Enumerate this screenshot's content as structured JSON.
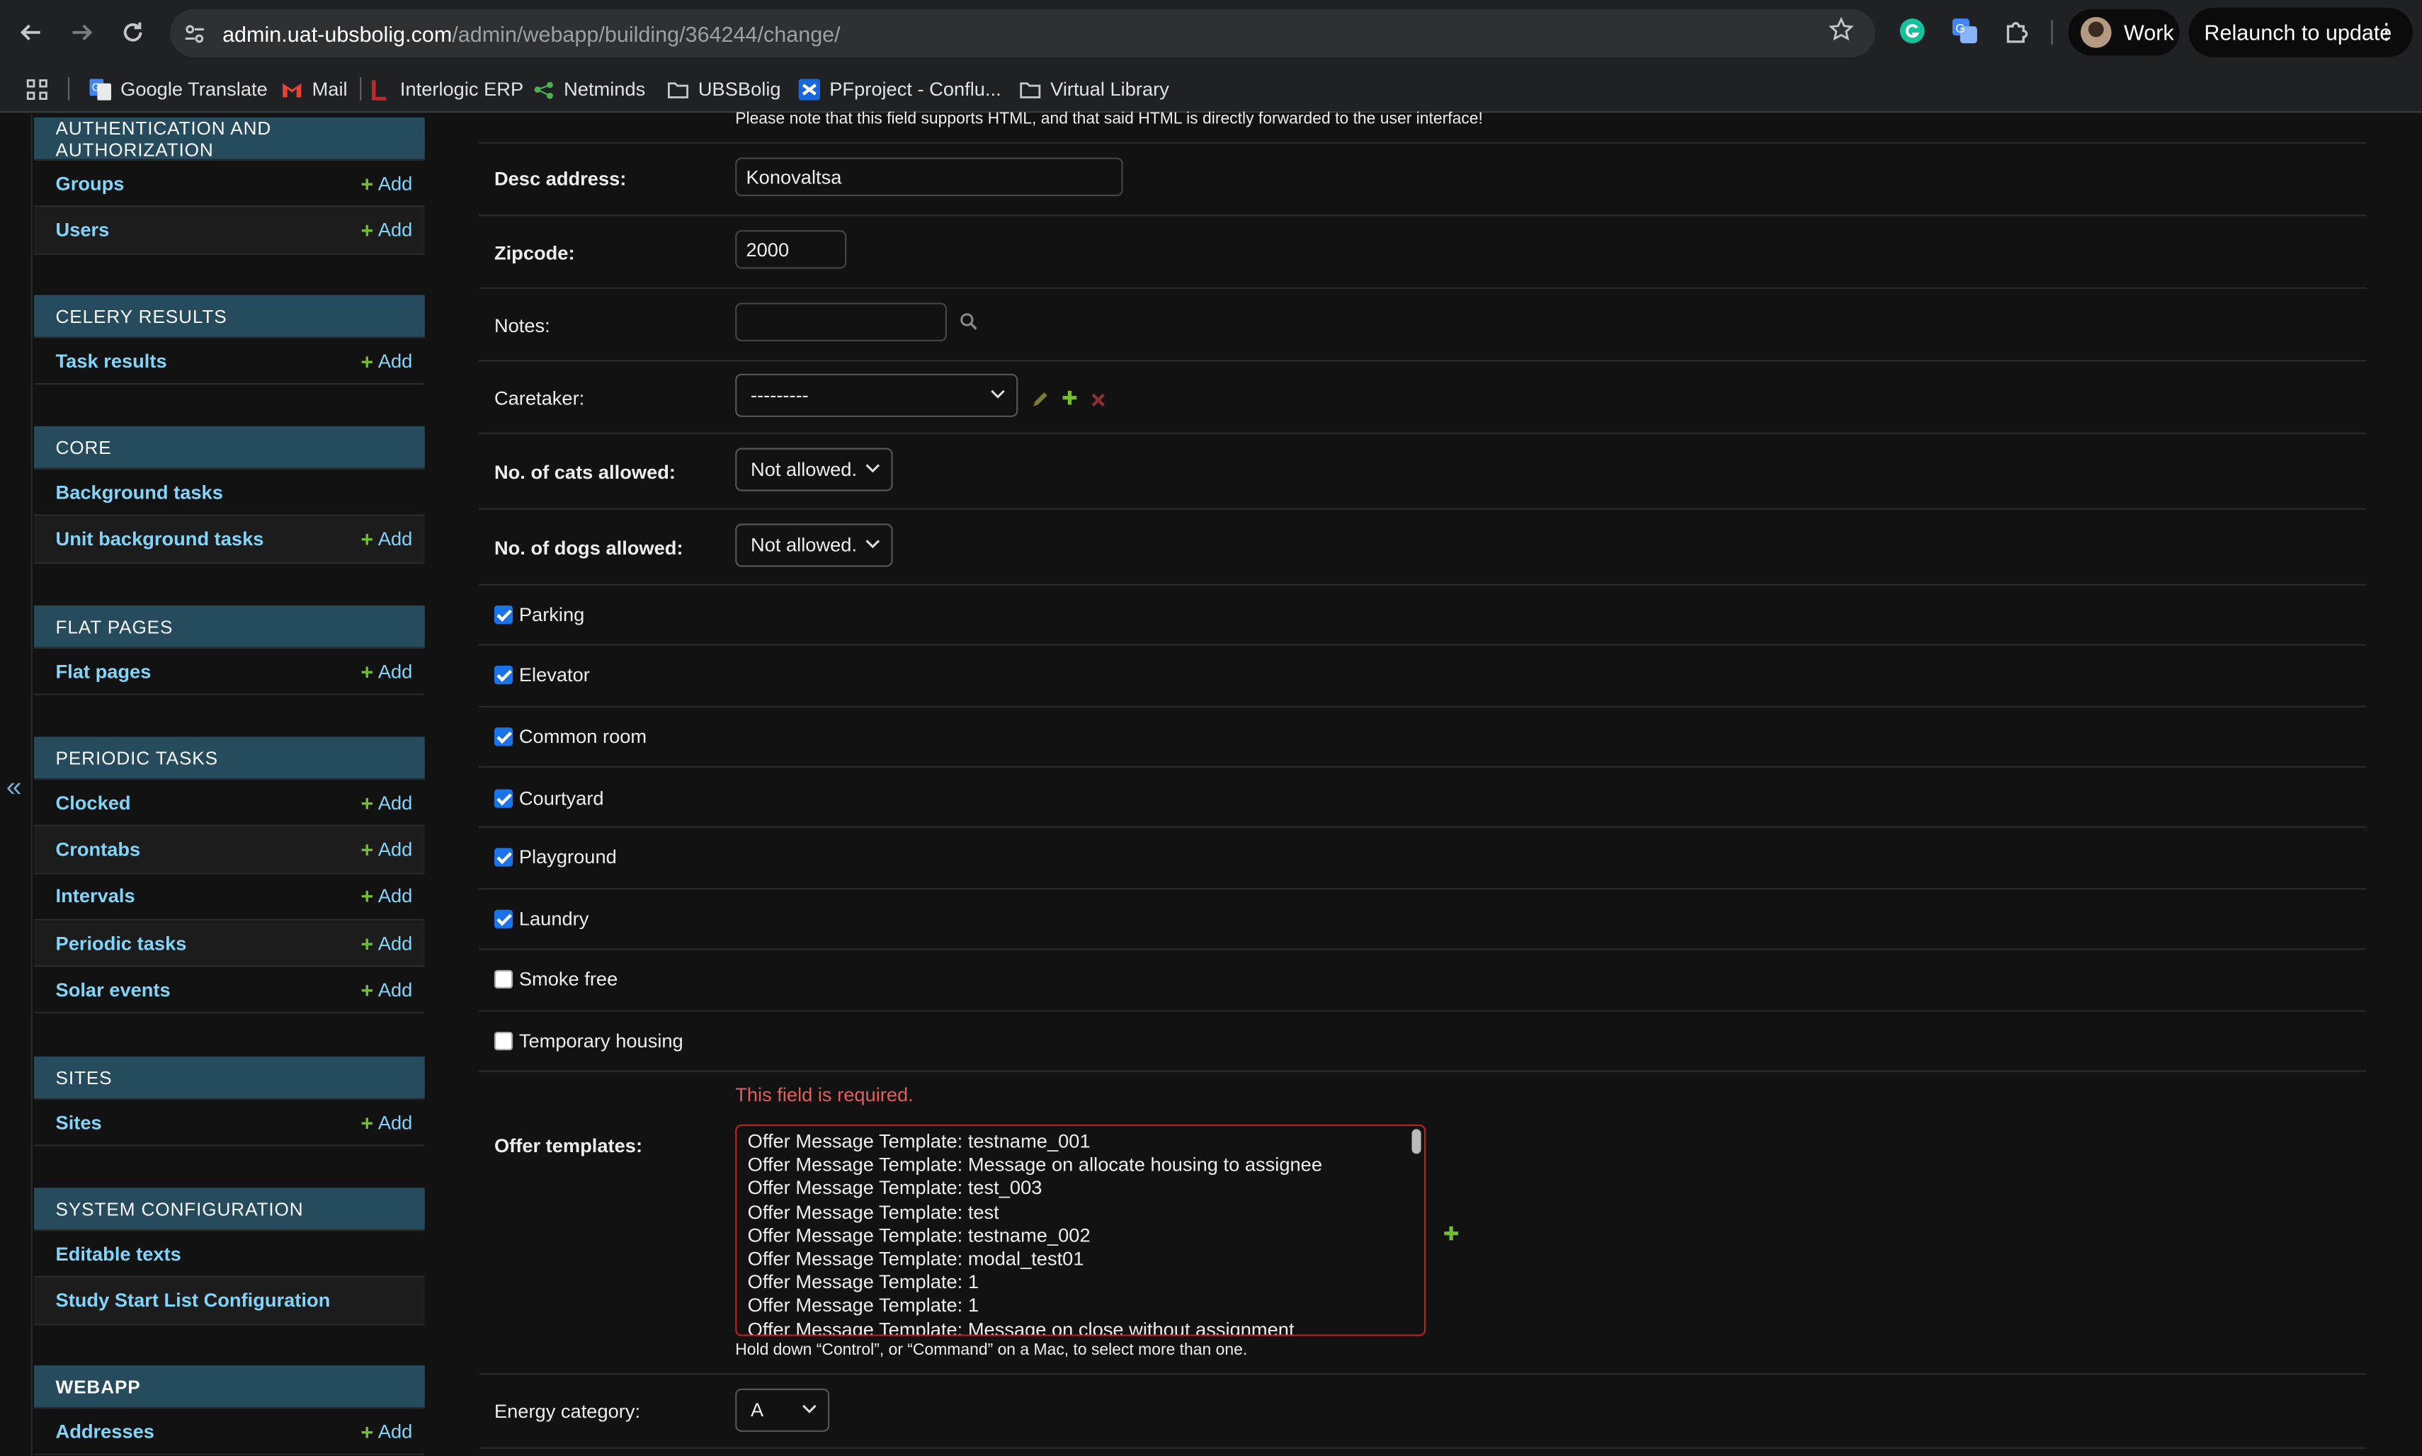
{
  "browser": {
    "url_domain": "admin.uat-ubsbolig.com",
    "url_path": "/admin/webapp/building/364244/change/",
    "profile_label": "Work",
    "relaunch_label": "Relaunch to update"
  },
  "bookmarks": [
    {
      "label": "Google Translate",
      "icon": "google-translate-icon"
    },
    {
      "label": "Mail",
      "icon": "gmail-icon"
    },
    {
      "label": "Interlogic ERP",
      "icon": "interlogic-icon"
    },
    {
      "label": "Netminds",
      "icon": "netminds-icon"
    },
    {
      "label": "UBSBolig",
      "icon": "folder-icon"
    },
    {
      "label": "PFproject - Conflu...",
      "icon": "confluence-icon"
    },
    {
      "label": "Virtual Library",
      "icon": "folder-icon"
    }
  ],
  "sidebar": {
    "collapse_glyph": "«",
    "add_label": "Add",
    "modules": [
      {
        "caption": "AUTHENTICATION AND AUTHORIZATION",
        "items": [
          {
            "label": "Groups",
            "add": true
          },
          {
            "label": "Users",
            "add": true
          }
        ]
      },
      {
        "caption": "CELERY RESULTS",
        "items": [
          {
            "label": "Task results",
            "add": true
          }
        ]
      },
      {
        "caption": "CORE",
        "items": [
          {
            "label": "Background tasks",
            "add": false
          },
          {
            "label": "Unit background tasks",
            "add": true
          }
        ]
      },
      {
        "caption": "FLAT PAGES",
        "items": [
          {
            "label": "Flat pages",
            "add": true
          }
        ]
      },
      {
        "caption": "PERIODIC TASKS",
        "items": [
          {
            "label": "Clocked",
            "add": true
          },
          {
            "label": "Crontabs",
            "add": true
          },
          {
            "label": "Intervals",
            "add": true
          },
          {
            "label": "Periodic tasks",
            "add": true
          },
          {
            "label": "Solar events",
            "add": true
          }
        ]
      },
      {
        "caption": "SITES",
        "items": [
          {
            "label": "Sites",
            "add": true
          }
        ]
      },
      {
        "caption": "SYSTEM CONFIGURATION",
        "items": [
          {
            "label": "Editable texts",
            "add": false
          },
          {
            "label": "Study Start List Configuration",
            "add": false
          }
        ]
      },
      {
        "caption": "WEBAPP",
        "items": [
          {
            "label": "Addresses",
            "add": true
          }
        ]
      }
    ]
  },
  "form": {
    "top_note": "Please note that this field supports HTML, and that said HTML is directly forwarded to the user interface!",
    "desc_address": {
      "label": "Desc address:",
      "value": "Konovaltsa"
    },
    "zipcode": {
      "label": "Zipcode:",
      "value": "2000"
    },
    "notes": {
      "label": "Notes:",
      "value": ""
    },
    "caretaker": {
      "label": "Caretaker:",
      "value": "---------"
    },
    "cats": {
      "label": "No. of cats allowed:",
      "value": "Not allowed."
    },
    "dogs": {
      "label": "No. of dogs allowed:",
      "value": "Not allowed."
    },
    "checkboxes": [
      {
        "label": "Parking",
        "checked": true
      },
      {
        "label": "Elevator",
        "checked": true
      },
      {
        "label": "Common room",
        "checked": true
      },
      {
        "label": "Courtyard",
        "checked": true
      },
      {
        "label": "Playground",
        "checked": true
      },
      {
        "label": "Laundry",
        "checked": true
      },
      {
        "label": "Smoke free",
        "checked": false
      },
      {
        "label": "Temporary housing",
        "checked": false
      }
    ],
    "offer_templates": {
      "label": "Offer templates:",
      "error": "This field is required.",
      "options": [
        "Offer Message Template: testname_001",
        "Offer Message Template: Message on allocate housing to assignee",
        "Offer Message Template: test_003",
        "Offer Message Template: test",
        "Offer Message Template: testname_002",
        "Offer Message Template: modal_test01",
        "Offer Message Template: 1",
        "Offer Message Template: 1",
        "Offer Message Template: Message on close without assignment"
      ],
      "help": "Hold down “Control”, or “Command” on a Mac, to select more than one."
    },
    "energy_category": {
      "label": "Energy category:",
      "value": "A"
    }
  },
  "colors": {
    "module_header": "#264b5d",
    "link": "#81d4fa",
    "add_plus": "#70bf2b",
    "error": "#e35d5d",
    "checkbox": "#1a73e8"
  }
}
